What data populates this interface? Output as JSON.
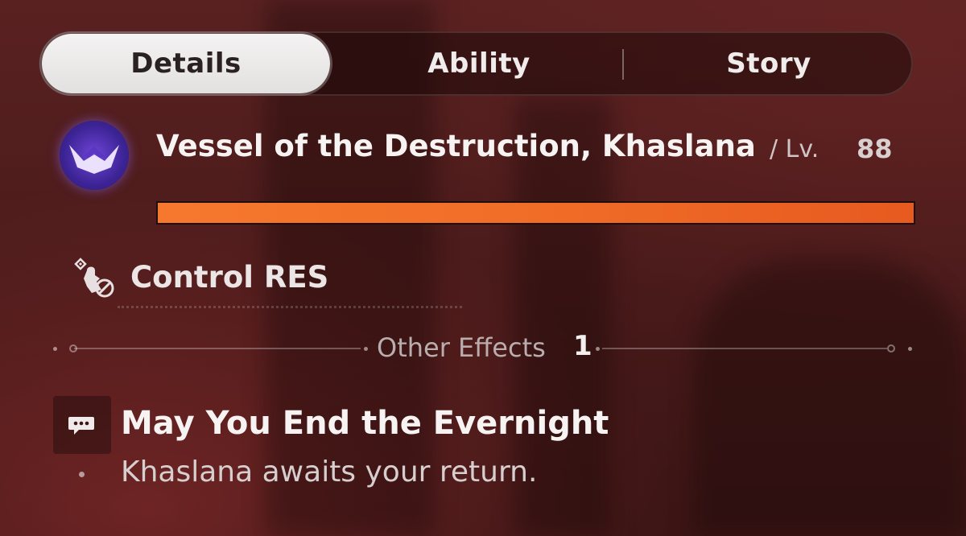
{
  "tabs": {
    "details": "Details",
    "ability": "Ability",
    "story": "Story",
    "active": "Details"
  },
  "boss": {
    "name": "Vessel of the Destruction, Khaslana",
    "level_label": "/ Lv.",
    "level": "88",
    "icon": "destruction-path-icon",
    "hp_fraction": 1.0,
    "hp_color": "#f06d27"
  },
  "resistance": {
    "label": "Control RES",
    "icon": "control-res-icon"
  },
  "other_effects": {
    "label": "Other Effects",
    "count": "1"
  },
  "effect": {
    "icon": "chat-bubble-icon",
    "title": "May You End the Evernight",
    "description": "Khaslana awaits your return."
  }
}
